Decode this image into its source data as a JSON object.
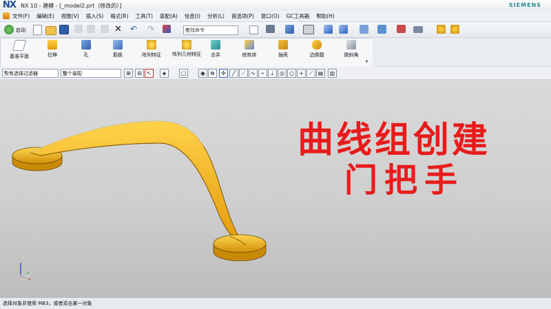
{
  "window": {
    "logo": "NX",
    "title": "NX 10 - 建模 - [_model2.prt（修改的）]",
    "brand": "SIEMENS"
  },
  "menubar": {
    "items": [
      "文件(F)",
      "编辑(E)",
      "视图(V)",
      "插入(S)",
      "格式(R)",
      "工具(T)",
      "装配(A)",
      "信息(I)",
      "分析(L)",
      "首选项(P)",
      "窗口(O)",
      "GC工具箱",
      "帮助(H)"
    ]
  },
  "toolbar": {
    "start_label": "启动·",
    "command_search_placeholder": "查找命令",
    "search_icon": "magnifier-icon"
  },
  "ribbon": {
    "items": [
      {
        "label": "基准平面",
        "icon": "datum-plane-icon"
      },
      {
        "label": "拉伸",
        "icon": "extrude-icon"
      },
      {
        "label": "孔",
        "icon": "hole-icon"
      },
      {
        "label": "筋板",
        "icon": "rib-icon"
      },
      {
        "label": "阵列特征",
        "icon": "pattern-feature-icon"
      },
      {
        "label": "阵列几何特征",
        "icon": "pattern-geometry-icon"
      },
      {
        "label": "合并",
        "icon": "unite-icon"
      },
      {
        "label": "修剪体",
        "icon": "trim-body-icon"
      },
      {
        "label": "抽壳",
        "icon": "shell-icon"
      },
      {
        "label": "边倒圆",
        "icon": "edge-blend-icon"
      },
      {
        "label": "倒斜角",
        "icon": "chamfer-icon"
      }
    ]
  },
  "selection_bar": {
    "filter_value": "没有选择过滤器",
    "scope_value": "整个装配"
  },
  "overlay": {
    "line1": "曲线组创建",
    "line2": "门把手"
  },
  "colors": {
    "overlay_text": "#e81c1c",
    "part_light": "#ffd24a",
    "part_mid": "#f2b012",
    "part_dark": "#c98a08"
  },
  "status": {
    "message": "选择对象并使用 MB3，或者双击某一对象"
  }
}
